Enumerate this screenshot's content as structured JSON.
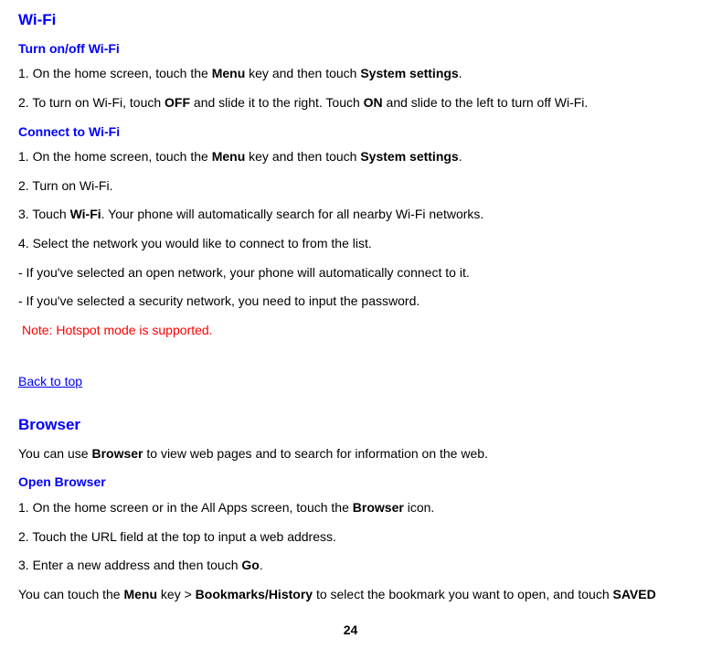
{
  "wifi": {
    "heading": "Wi-Fi",
    "turnOnOff": {
      "heading": "Turn on/off Wi-Fi",
      "step1_pre": "1. On the home screen, touch the ",
      "step1_menu": "Menu",
      "step1_mid": " key and then touch ",
      "step1_settings": "System settings",
      "step1_end": ".",
      "step2_pre": "2. To turn on Wi-Fi, touch ",
      "step2_off": "OFF",
      "step2_mid": " and slide it to the right. Touch ",
      "step2_on": "ON",
      "step2_end": " and slide to the left to turn off Wi-Fi."
    },
    "connect": {
      "heading": "Connect to Wi-Fi",
      "step1_pre": "1. On the home screen, touch the ",
      "step1_menu": "Menu",
      "step1_mid": " key and then touch ",
      "step1_settings": "System settings",
      "step1_end": ".",
      "step2": "2. Turn on Wi-Fi.",
      "step3_pre": "3. Touch ",
      "step3_wifi": "Wi-Fi",
      "step3_end": ". Your phone will automatically search for all nearby Wi-Fi networks.",
      "step4": "4. Select the network you would like to connect to from the list.",
      "bullet1": "- If you've selected an open network, your phone will automatically connect to it.",
      "bullet2": "- If you've selected a security network, you need to input the password.",
      "note": "Note: Hotspot mode is supported."
    }
  },
  "backToTop": "Back to top",
  "browser": {
    "heading": "Browser",
    "intro_pre": "You can use ",
    "intro_browser": "Browser",
    "intro_end": " to view web pages and to search for information on the web.",
    "open": {
      "heading": "Open Browser",
      "step1_pre": "1. On the home screen or in the All Apps screen, touch the ",
      "step1_browser": "Browser",
      "step1_end": " icon.",
      "step2": "2. Touch the URL field at the top to input a web address.",
      "step3_pre": "3. Enter a new address and then touch ",
      "step3_go": "Go",
      "step3_end": ".",
      "last_pre": "You can touch the ",
      "last_menu": "Menu",
      "last_mid1": " key > ",
      "last_bookmarks": "Bookmarks/History",
      "last_mid2": " to select the bookmark you want to open, and touch ",
      "last_saved": "SAVED"
    }
  },
  "pageNumber": "24"
}
